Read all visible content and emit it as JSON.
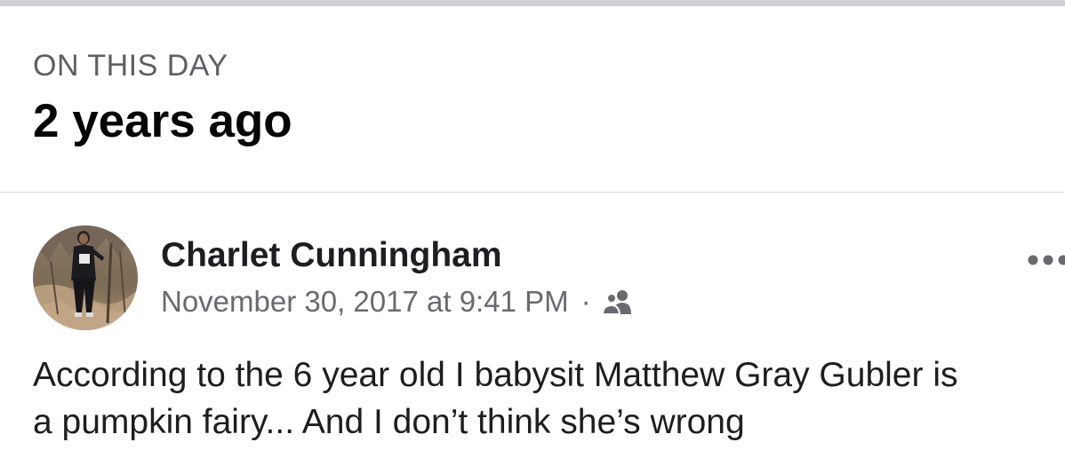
{
  "memory": {
    "eyebrow": "ON THIS DAY",
    "headline": "2 years ago"
  },
  "post": {
    "author": "Charlet Cunningham",
    "timestamp": "November 30, 2017 at 9:41 PM",
    "separator": "·",
    "audience_icon": "friends-icon",
    "more_icon": "more-options-icon",
    "text": "According to the 6 year old I babysit Matthew Gray Gubler is\na pumpkin fairy... And I don’t think she’s wrong"
  },
  "colors": {
    "text_primary": "#1c1e21",
    "text_secondary": "#686a6f",
    "divider": "#dcdde0",
    "top_bar": "#cfd0d4"
  }
}
